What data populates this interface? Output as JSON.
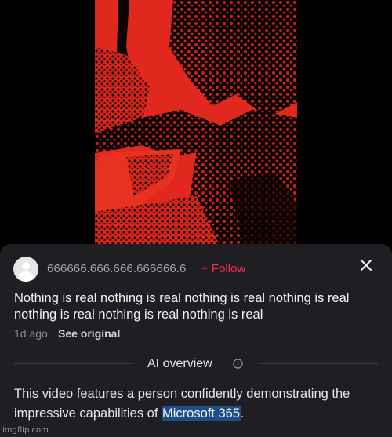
{
  "video": {
    "tint_color": "#e0281e",
    "shadow_color": "#0c0303"
  },
  "post": {
    "username": "666666.666.666.666666.6",
    "follow_label": "+ Follow",
    "caption": "Nothing is real nothing is real nothing is real nothing is real nothing is real nothing is real nothing is real",
    "time_ago": "1d ago",
    "see_original_label": "See original",
    "close_icon": "close-icon",
    "avatar_icon": "default-avatar-icon"
  },
  "ai_overview": {
    "title": "AI overview",
    "info_icon": "info-icon",
    "text_before": "This video features a person confidently demonstrating the impressive capabilities of ",
    "highlighted": "Microsoft 365",
    "text_after": ".",
    "highlight_color": "#1d4f86"
  },
  "watermark": "imgflip.com",
  "colors": {
    "accent": "#fe2c55",
    "sheet_bg": "#1f1f23"
  }
}
